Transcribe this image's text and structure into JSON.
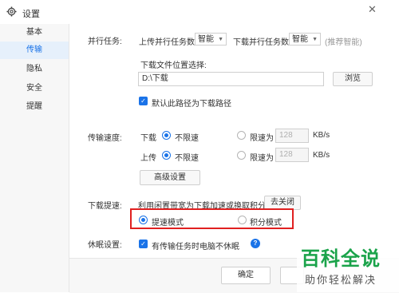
{
  "window": {
    "title": "设置",
    "icon": "gear-icon"
  },
  "sidebar": {
    "items": [
      {
        "label": "基本"
      },
      {
        "label": "传输"
      },
      {
        "label": "隐私"
      },
      {
        "label": "安全"
      },
      {
        "label": "提醒"
      }
    ],
    "active_index": 1
  },
  "parallel": {
    "section_label": "并行任务:",
    "upload_label": "上传并行任务数",
    "upload_value": "智能",
    "download_label": "下载并行任务数",
    "download_value": "智能",
    "hint": "(推荐智能)"
  },
  "download_location": {
    "label": "下载文件位置选择:",
    "path": "D:\\下载",
    "browse_label": "浏览",
    "default_checkbox_label": "默认此路径为下载路径",
    "default_checked": true
  },
  "speed": {
    "section_label": "传输速度:",
    "download_label": "下载",
    "upload_label": "上传",
    "unlimited_label": "不限速",
    "limit_label": "限速为",
    "download_limit_value": "128",
    "upload_limit_value": "128",
    "unit": "KB/s",
    "advanced_button": "高级设置"
  },
  "accelerate": {
    "section_label": "下载提速:",
    "description": "利用闲置带宽为下载加速或换取积分",
    "close_button": "去关闭",
    "option_speed": "提速模式",
    "option_points": "积分模式",
    "selected": "提速模式"
  },
  "sleep": {
    "section_label": "休眠设置:",
    "checkbox_label": "有传输任务时电脑不休眠",
    "checked": true
  },
  "footer": {
    "ok_label": "确定"
  },
  "watermark": {
    "line1": "百科全说",
    "line2": "助你轻松解决"
  },
  "colors": {
    "accent": "#1a73e8",
    "highlight_box": "#e02020",
    "watermark": "#1aa34a"
  }
}
